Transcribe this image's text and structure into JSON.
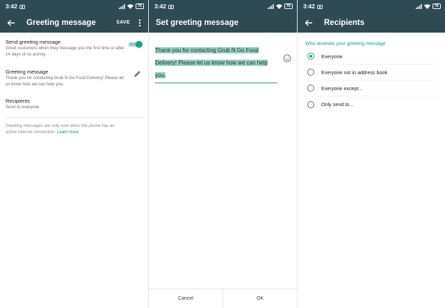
{
  "status": {
    "time": "3:42",
    "battery": "76"
  },
  "screen1": {
    "title": "Greeting message",
    "save_label": "SAVE",
    "send_greeting": {
      "title": "Send greeting message",
      "subtitle": "Greet customers when they message you the first time or after 14 days of no activity",
      "enabled": true
    },
    "greeting": {
      "title": "Greeting message",
      "subtitle": "Thank you for contacting Grub N Go Food Delivery! Please let us know how we can help you."
    },
    "recipients": {
      "title": "Recipients",
      "subtitle": "Send to everyone"
    },
    "note": "Greeting messages are only sent when the phone has an active Internet connection.",
    "learn_more": "Learn more"
  },
  "screen2": {
    "title": "Set greeting message",
    "message_text": "Thank you for contacting Grub N Go Food Delivery! Please let us know how we can help you.",
    "cancel_label": "Cancel",
    "ok_label": "OK"
  },
  "screen3": {
    "title": "Recipients",
    "section_label": "Who receives your greeting message",
    "options": [
      {
        "label": "Everyone",
        "selected": true
      },
      {
        "label": "Everyone not in address book",
        "selected": false
      },
      {
        "label": "Everyone except...",
        "selected": false
      },
      {
        "label": "Only send to...",
        "selected": false
      }
    ]
  },
  "colors": {
    "header": "#2e4a55",
    "accent": "#1aa08a",
    "selection": "#8fd2c3"
  }
}
